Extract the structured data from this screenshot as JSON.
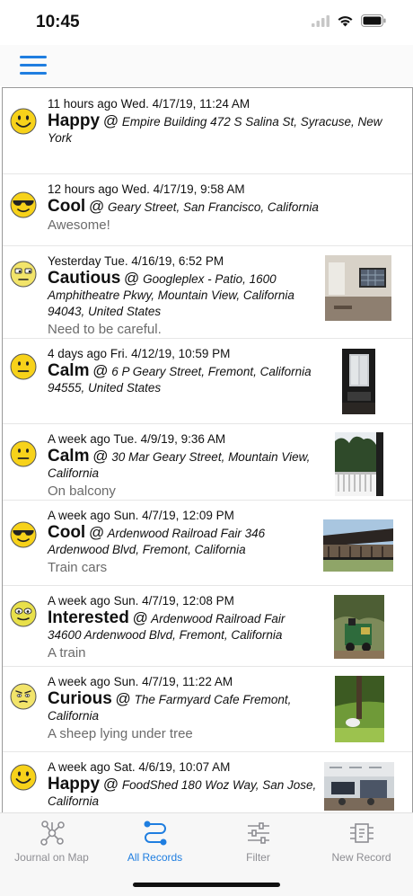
{
  "status": {
    "time": "10:45"
  },
  "records": [
    {
      "when": "11 hours ago",
      "date": "Wed. 4/17/19, 11:24 AM",
      "mood": "Happy",
      "location": "Empire Building 472 S Salina St, Syracuse, New York",
      "note": "",
      "emoji": "happy-emoji-icon",
      "photo": ""
    },
    {
      "when": "12 hours ago",
      "date": "Wed. 4/17/19, 9:58 AM",
      "mood": "Cool",
      "location": "Geary Street, San Francisco, California",
      "note": "Awesome!",
      "emoji": "cool-emoji-icon",
      "photo": ""
    },
    {
      "when": "Yesterday",
      "date": "Tue. 4/16/19, 6:52 PM",
      "mood": "Cautious",
      "location": "Googleplex - Patio, 1600 Amphitheatre Pkwy, Mountain View, California 94043, United States",
      "note": "Need to be careful.",
      "emoji": "cautious-emoji-icon",
      "photo": "room-photo"
    },
    {
      "when": "4 days ago",
      "date": "Fri. 4/12/19, 10:59 PM",
      "mood": "Calm",
      "location": "6 P Geary Street, Fremont, California 94555, United States",
      "note": "",
      "emoji": "calm-emoji-icon",
      "photo": "window-photo"
    },
    {
      "when": "A week ago",
      "date": "Tue. 4/9/19, 9:36 AM",
      "mood": "Calm",
      "location": "30 Mar Geary Street, Mountain View, California",
      "note": "On balcony",
      "emoji": "calm-emoji-icon",
      "photo": "balcony-photo"
    },
    {
      "when": "A week ago",
      "date": "Sun. 4/7/19, 12:09 PM",
      "mood": "Cool",
      "location": "Ardenwood Railroad Fair 346 Ardenwood Blvd, Fremont, California",
      "note": "Train cars",
      "emoji": "cool-emoji-icon",
      "photo": "train-cars-photo"
    },
    {
      "when": "A week ago",
      "date": "Sun. 4/7/19, 12:08 PM",
      "mood": "Interested",
      "location": "Ardenwood Railroad Fair 34600 Ardenwood Blvd, Fremont, California",
      "note": "A train",
      "emoji": "interested-emoji-icon",
      "photo": "train-photo"
    },
    {
      "when": "A week ago",
      "date": "Sun. 4/7/19, 11:22 AM",
      "mood": "Curious",
      "location": "The Farmyard Cafe Fremont, California",
      "note": "A sheep lying under tree",
      "emoji": "curious-emoji-icon",
      "photo": "sheep-photo"
    },
    {
      "when": "A week ago",
      "date": "Sat. 4/6/19, 10:07 AM",
      "mood": "Happy",
      "location": "FoodShed 180 Woz Way, San Jose, California",
      "note": "",
      "emoji": "happy-emoji-icon",
      "photo": "office-photo"
    }
  ],
  "tabs": [
    {
      "label": "Journal on Map",
      "icon": "map-network-icon",
      "active": false
    },
    {
      "label": "All Records",
      "icon": "records-icon",
      "active": true
    },
    {
      "label": "Filter",
      "icon": "filter-sliders-icon",
      "active": false
    },
    {
      "label": "New Record",
      "icon": "new-record-icon",
      "active": false
    }
  ],
  "colors": {
    "accent": "#1f7ee0",
    "inactive": "#8e8e93",
    "emoji_yellow": "#f7d21a"
  }
}
